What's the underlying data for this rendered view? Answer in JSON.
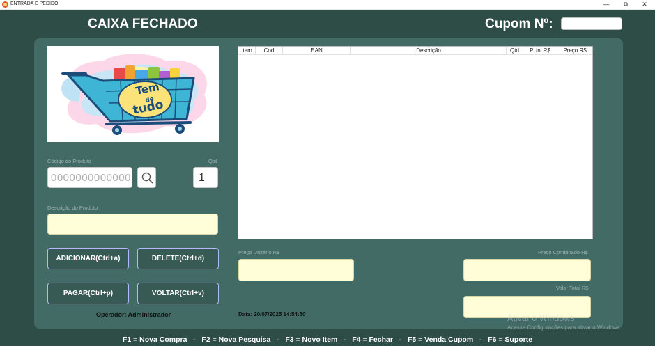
{
  "window": {
    "title": "ENTRADA E PEDIDO",
    "minimize_glyph": "—",
    "restore_glyph": "⧉",
    "close_glyph": "✕"
  },
  "header": {
    "status": "CAIXA FECHADO",
    "cupom_label": "Cupom Nº:",
    "cupom_value": ""
  },
  "logo": {
    "text_line1": "Tem",
    "text_line2": "de",
    "text_line3": "tudo"
  },
  "product": {
    "code_label": "Código do Produto",
    "code_placeholder": "0000000000000",
    "qty_label": "Qtd",
    "qty_value": "1",
    "desc_label": "Descrição do Produto",
    "desc_value": ""
  },
  "buttons": {
    "add": "ADICIONAR(Ctrl+a)",
    "delete": "DELETE(Ctrl+d)",
    "pay": "PAGAR(Ctrl+p)",
    "back": "VOLTAR(Ctrl+v)"
  },
  "table": {
    "columns": [
      "Item",
      "Cod",
      "EAN",
      "Descrição",
      "Qtd",
      "PUni R$",
      "Preço R$"
    ],
    "rows": []
  },
  "totals": {
    "unit_price_label": "Preço Unitário R$",
    "combined_price_label": "Preço Combinado R$",
    "total_label": "Valor Total R$"
  },
  "status": {
    "operator": "Operador: Administrador",
    "date": "Data: 20/07/2025 14:54:50"
  },
  "footer": {
    "shortcuts": "F1 = Nova Compra   -   F2 = Nova Pesquisa   -   F3 = Novo Item   -   F4 = Fechar   -   F5 = Venda Cupom   -   F6 = Suporte"
  },
  "watermark": {
    "line1": "Ativar o Windows",
    "line2": "Acesse Configurações para ativar o Windows."
  },
  "colors": {
    "background": "#2f4d47",
    "panel": "#426b66",
    "button": "#385a55",
    "button_border": "#b5b8ff",
    "field_yellow": "#fffed9"
  }
}
